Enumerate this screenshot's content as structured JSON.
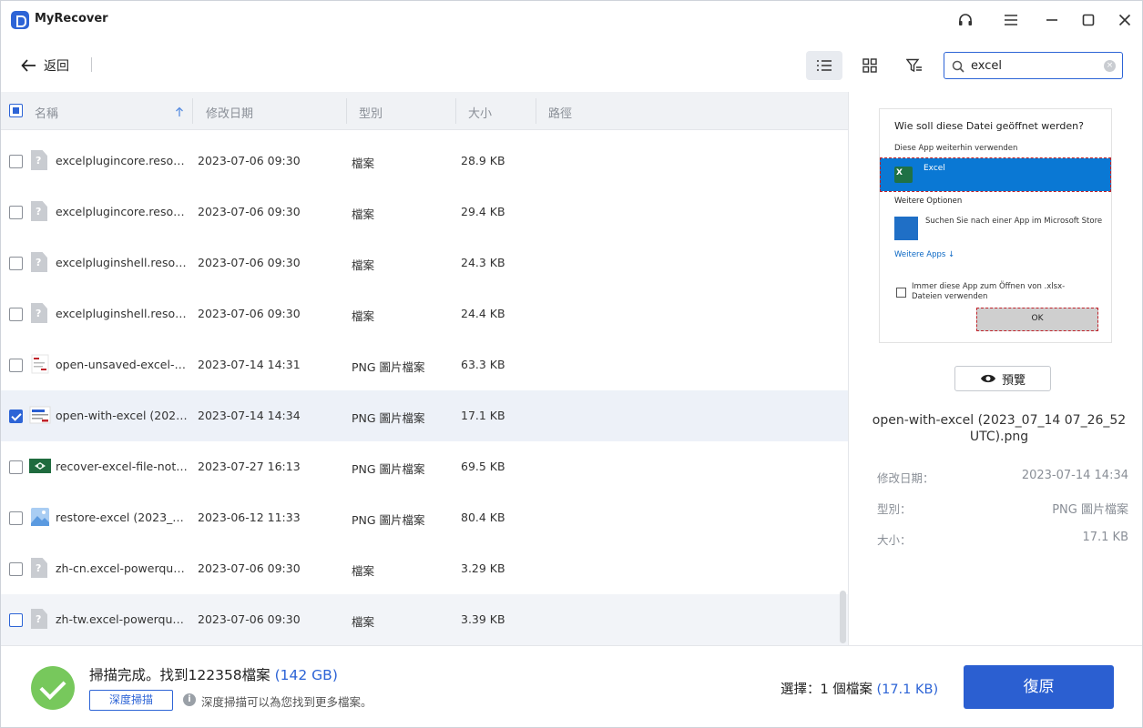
{
  "app": {
    "title": "MyRecover"
  },
  "toolbar": {
    "back_label": "返回"
  },
  "search": {
    "value": "excel",
    "clear_label": "×"
  },
  "columns": {
    "name": "名稱",
    "date": "修改日期",
    "type": "型別",
    "size": "大小",
    "path": "路徑"
  },
  "rows": [
    {
      "name": "excelplugincore.resourc...",
      "date": "2023-07-06 09:30",
      "type": "檔案",
      "size": "28.9 KB"
    },
    {
      "name": "excelplugincore.resourc...",
      "date": "2023-07-06 09:30",
      "type": "檔案",
      "size": "29.4 KB"
    },
    {
      "name": "excelpluginshell.resourc...",
      "date": "2023-07-06 09:30",
      "type": "檔案",
      "size": "24.3 KB"
    },
    {
      "name": "excelpluginshell.resourc...",
      "date": "2023-07-06 09:30",
      "type": "檔案",
      "size": "24.4 KB"
    },
    {
      "name": "open-unsaved-excel-fil...",
      "date": "2023-07-14 14:31",
      "type": "PNG 圖片檔案",
      "size": "63.3 KB"
    },
    {
      "name": "open-with-excel (2023_...",
      "date": "2023-07-14 14:34",
      "type": "PNG 圖片檔案",
      "size": "17.1 KB"
    },
    {
      "name": "recover-excel-file-not-s...",
      "date": "2023-07-27 16:13",
      "type": "PNG 圖片檔案",
      "size": "69.5 KB"
    },
    {
      "name": "restore-excel (2023_06_...",
      "date": "2023-06-12 11:33",
      "type": "PNG 圖片檔案",
      "size": "80.4 KB"
    },
    {
      "name": "zh-cn.excel-powerquery...",
      "date": "2023-07-06 09:30",
      "type": "檔案",
      "size": "3.29 KB"
    },
    {
      "name": "zh-tw.excel-powerquery...",
      "date": "2023-07-06 09:30",
      "type": "檔案",
      "size": "3.39 KB"
    }
  ],
  "preview_image": {
    "dialog_title": "Wie soll diese Datei geöffnet werden?",
    "keep_using": "Diese App weiterhin verwenden",
    "excel_label": "Excel",
    "more_options": "Weitere Optionen",
    "store_text": "Suchen Sie nach einer App im Microsoft Store",
    "more_apps": "Weitere Apps ↓",
    "always_use": "Immer diese App zum Öffnen von .xlsx-Dateien verwenden",
    "ok_label": "OK"
  },
  "preview": {
    "button_label": "預覽",
    "filename": "open-with-excel (2023_07_14 07_26_52 UTC).png",
    "modified_label": "修改日期：",
    "modified_value": "2023-07-14 14:34",
    "type_label": "型別：",
    "type_value": "PNG 圖片檔案",
    "size_label": "大小：",
    "size_value": "17.1 KB"
  },
  "footer": {
    "scan_done": "掃描完成。找到122358檔案",
    "scan_size": "(142 GB)",
    "deep_scan_label": "深度掃描",
    "hint": "深度掃描可以為您找到更多檔案。",
    "selected_prefix": "選擇：1 個檔案",
    "selected_size": "(17.1 KB)",
    "recover_label": "復原"
  },
  "colors": {
    "accent": "#2d64d6",
    "success": "#77c85c",
    "selected_row": "#edf1f8"
  }
}
